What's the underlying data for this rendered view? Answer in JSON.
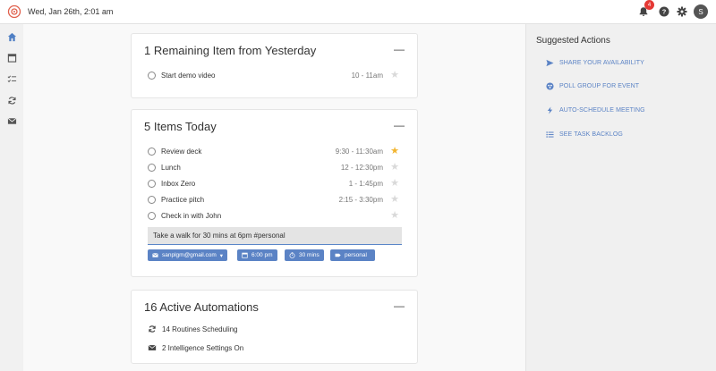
{
  "topbar": {
    "date": "Wed, Jan 26th, 2:01 am",
    "notification_count": "4",
    "avatar_initial": "S"
  },
  "nav": {
    "items": [
      "home-icon",
      "calendar-icon",
      "checklist-icon",
      "sync-icon",
      "mail-icon"
    ]
  },
  "yesterday": {
    "title": "1 Remaining Item from Yesterday",
    "tasks": [
      {
        "label": "Start demo video",
        "time": "10 - 11am",
        "starred": false
      }
    ]
  },
  "today": {
    "title": "5 Items Today",
    "tasks": [
      {
        "label": "Review deck",
        "time": "9:30 - 11:30am",
        "starred": true
      },
      {
        "label": "Lunch",
        "time": "12 - 12:30pm",
        "starred": false
      },
      {
        "label": "Inbox Zero",
        "time": "1 - 1:45pm",
        "starred": false
      },
      {
        "label": "Practice pitch",
        "time": "2:15 - 3:30pm",
        "starred": false
      },
      {
        "label": "Check in with John",
        "time": "",
        "starred": false
      }
    ],
    "input_value": "Take a walk for 30 mins at 6pm #personal",
    "chips": {
      "account": "sanplgm@gmail.com",
      "time": "6:00 pm",
      "duration": "30 mins",
      "tag": "personal"
    }
  },
  "automations": {
    "title": "16 Active Automations",
    "items": [
      {
        "label": "14 Routines Scheduling"
      },
      {
        "label": "2 Intelligence Settings On"
      }
    ]
  },
  "suggested": {
    "title": "Suggested Actions",
    "actions": [
      {
        "label": "SHARE YOUR AVAILABILITY"
      },
      {
        "label": "POLL GROUP FOR EVENT"
      },
      {
        "label": "AUTO-SCHEDULE MEETING"
      },
      {
        "label": "SEE TASK BACKLOG"
      }
    ]
  },
  "colors": {
    "accent": "#5b83c5",
    "star_on": "#f2b530",
    "badge": "#e53935"
  }
}
